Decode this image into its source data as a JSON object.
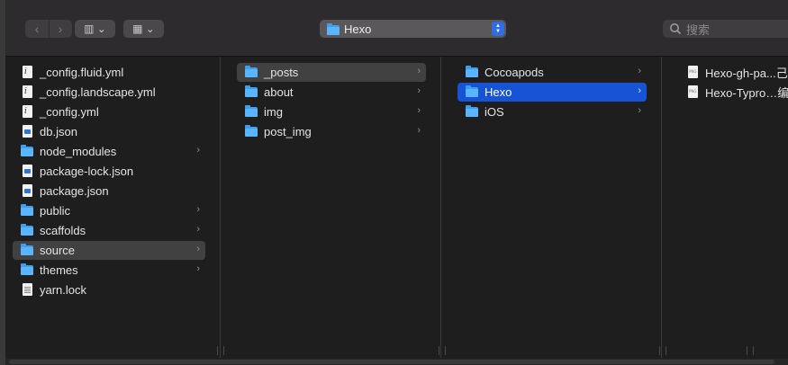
{
  "toolbar": {
    "back_icon": "‹",
    "forward_icon": "›",
    "view_column_label": "▥ ⌄",
    "group_label": "▦ ⌄",
    "path_title": "Hexo",
    "search_placeholder": "搜索"
  },
  "columns": [
    {
      "items": [
        {
          "label": "_config.fluid.yml",
          "icon": "doc-icon"
        },
        {
          "label": "_config.landscape.yml",
          "icon": "doc-icon"
        },
        {
          "label": "_config.yml",
          "icon": "doc-icon"
        },
        {
          "label": "db.json",
          "icon": "json-icon"
        },
        {
          "label": "node_modules",
          "icon": "folder-icon",
          "chevron": "›"
        },
        {
          "label": "package-lock.json",
          "icon": "json-icon"
        },
        {
          "label": "package.json",
          "icon": "json-icon"
        },
        {
          "label": "public",
          "icon": "folder-icon",
          "chevron": "›"
        },
        {
          "label": "scaffolds",
          "icon": "folder-icon",
          "chevron": "›"
        },
        {
          "label": "source",
          "icon": "folder-icon",
          "chevron": "›"
        },
        {
          "label": "themes",
          "icon": "folder-icon",
          "chevron": "›"
        },
        {
          "label": "yarn.lock",
          "icon": "lock-icon"
        }
      ]
    },
    {
      "items": [
        {
          "label": "_posts",
          "icon": "folder-icon",
          "chevron": "›"
        },
        {
          "label": "about",
          "icon": "folder-icon",
          "chevron": "›"
        },
        {
          "label": "img",
          "icon": "folder-icon",
          "chevron": "›"
        },
        {
          "label": "post_img",
          "icon": "folder-icon",
          "chevron": "›"
        }
      ]
    },
    {
      "items": [
        {
          "label": "Cocoapods",
          "icon": "folder-icon",
          "chevron": "›"
        },
        {
          "label": "Hexo",
          "icon": "folder-icon",
          "chevron": "›"
        },
        {
          "label": "iOS",
          "icon": "folder-icon",
          "chevron": "›"
        }
      ]
    },
    {
      "items": [
        {
          "label": "Hexo-gh-pa...己",
          "icon": "png-icon"
        },
        {
          "label": "Hexo-Typro…编",
          "icon": "png-icon"
        }
      ]
    }
  ]
}
